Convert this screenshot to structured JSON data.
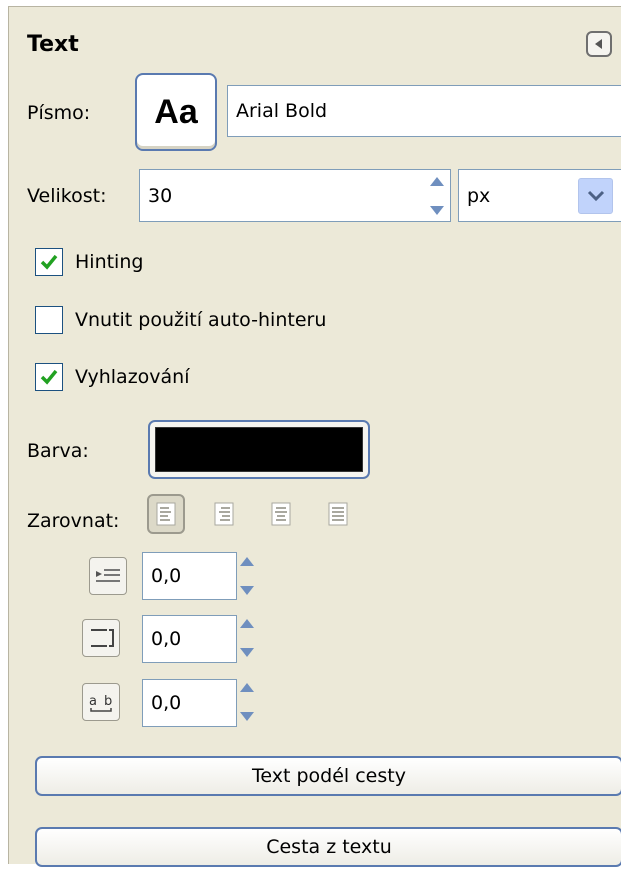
{
  "panel": {
    "title": "Text",
    "collapse_icon": "triangle-left-icon"
  },
  "font": {
    "label": "Písmo:",
    "preview": "Aa",
    "value": "Arial Bold"
  },
  "size": {
    "label": "Velikost:",
    "value": "30",
    "unit": "px"
  },
  "options": [
    {
      "label": "Hinting",
      "checked": true
    },
    {
      "label": "Vnutit použití auto-hinteru",
      "checked": false
    },
    {
      "label": "Vyhlazování",
      "checked": true
    }
  ],
  "color": {
    "label": "Barva:",
    "value": "#000000"
  },
  "justify": {
    "label": "Zarovnat:",
    "modes": [
      "left",
      "right",
      "center",
      "fill"
    ],
    "active": "left"
  },
  "spacing": {
    "indent": "0,0",
    "line_spacing": "0,0",
    "letter_spacing": "0,0"
  },
  "buttons": {
    "text_along_path": "Text podél cesty",
    "path_from_text": "Cesta z textu"
  },
  "colors": {
    "check": "#21a121",
    "accent": "#5a7ab0",
    "panel_bg": "#ece9d8"
  }
}
